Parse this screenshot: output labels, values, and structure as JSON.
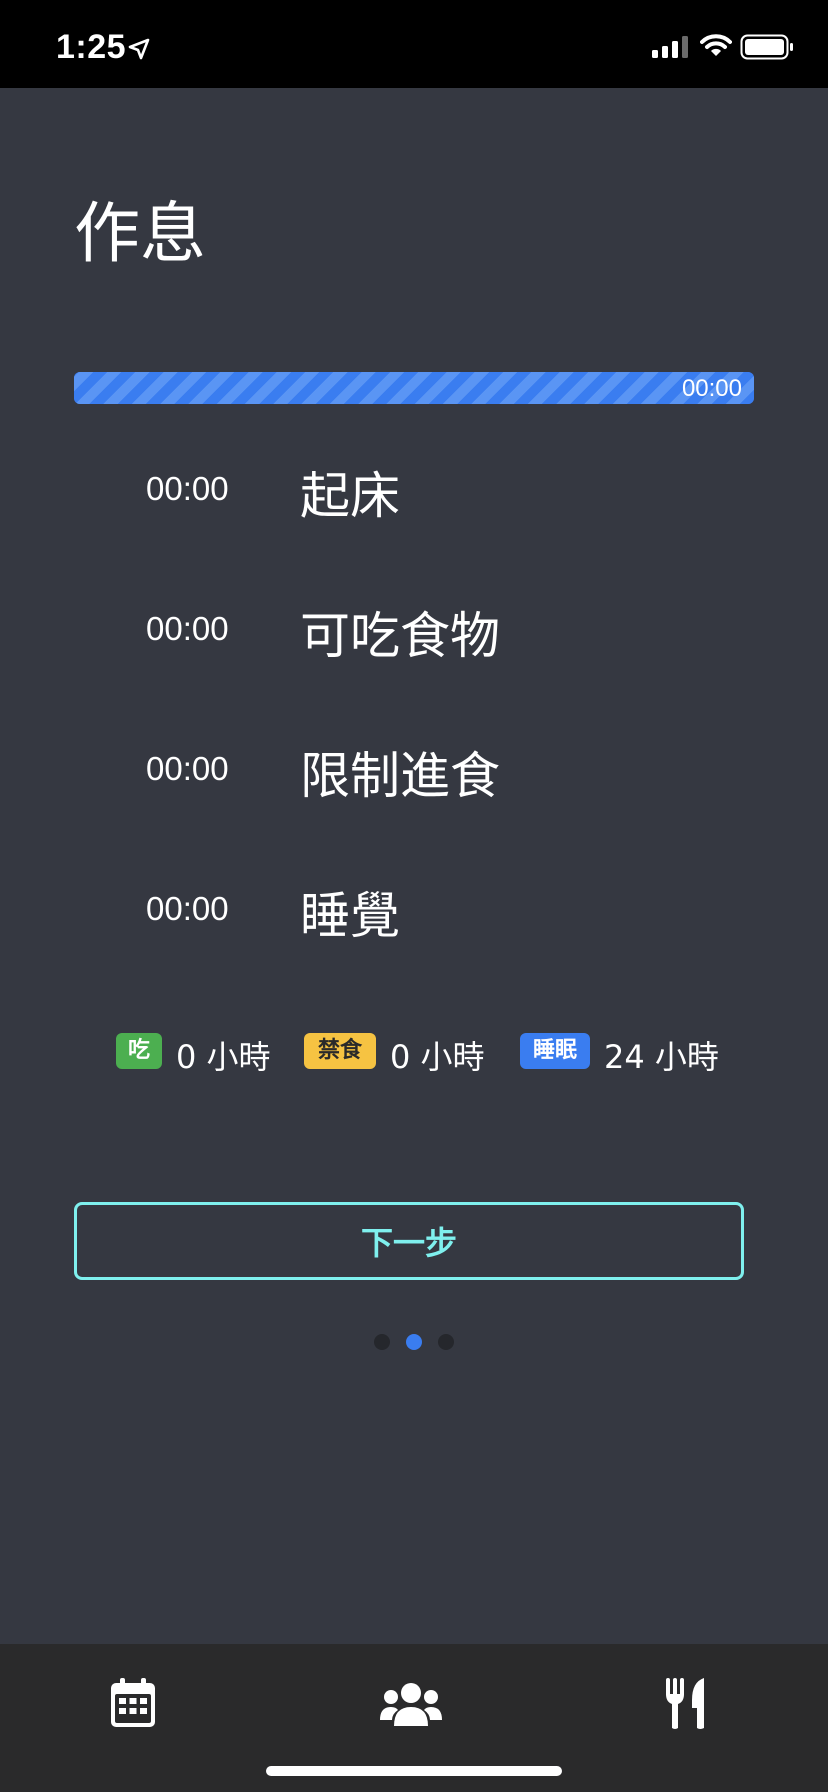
{
  "status_bar": {
    "time": "1:25",
    "icons": [
      "location-arrow-icon",
      "signal-icon",
      "wifi-icon",
      "battery-icon"
    ]
  },
  "title": "作息",
  "progress": {
    "time": "00:00",
    "fill_fraction": 1.0,
    "color": "#3a7df0"
  },
  "schedule": [
    {
      "time": "00:00",
      "label": "起床"
    },
    {
      "time": "00:00",
      "label": "可吃食物"
    },
    {
      "time": "00:00",
      "label": "限制進食"
    },
    {
      "time": "00:00",
      "label": "睡覺"
    }
  ],
  "summary": [
    {
      "badge": "吃",
      "value": "0 小時",
      "color": "#4caf50"
    },
    {
      "badge": "禁食",
      "value": "0 小時",
      "color": "#f6c342"
    },
    {
      "badge": "睡眠",
      "value": "24 小時",
      "color": "#3a7df0"
    }
  ],
  "next_button": {
    "label": "下一步",
    "color": "#7ff0ee"
  },
  "pager": {
    "count": 3,
    "active_index": 1
  },
  "tabs": [
    {
      "icon": "calendar-icon"
    },
    {
      "icon": "users-icon"
    },
    {
      "icon": "utensils-icon"
    }
  ]
}
